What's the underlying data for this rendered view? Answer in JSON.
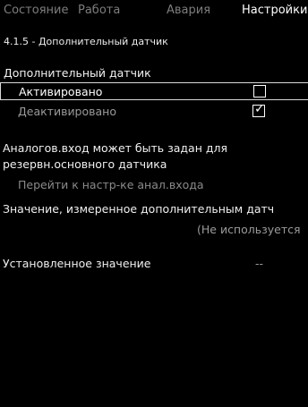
{
  "tabs": [
    {
      "label": "Состояние"
    },
    {
      "label": "Работа"
    },
    {
      "label": "Авария"
    },
    {
      "label": "Настройки"
    }
  ],
  "screen_id": "4.1.5 - Дополнительный датчик",
  "section_title": "Дополнительный датчик",
  "options": [
    {
      "label": "Активировано",
      "checked": false
    },
    {
      "label": "Деактивировано",
      "checked": true
    }
  ],
  "check_mark": "✓",
  "info_text_line1": "Аналогов.вход может быть задан для",
  "info_text_line2": "резервн.основного датчика",
  "link_text": "Перейти к настр-ке анал.входа",
  "measured_label": "Значение, измеренное дополнительным датч",
  "measured_value": "(Не используется",
  "setpoint_label": "Установленное значение",
  "setpoint_value": "--"
}
